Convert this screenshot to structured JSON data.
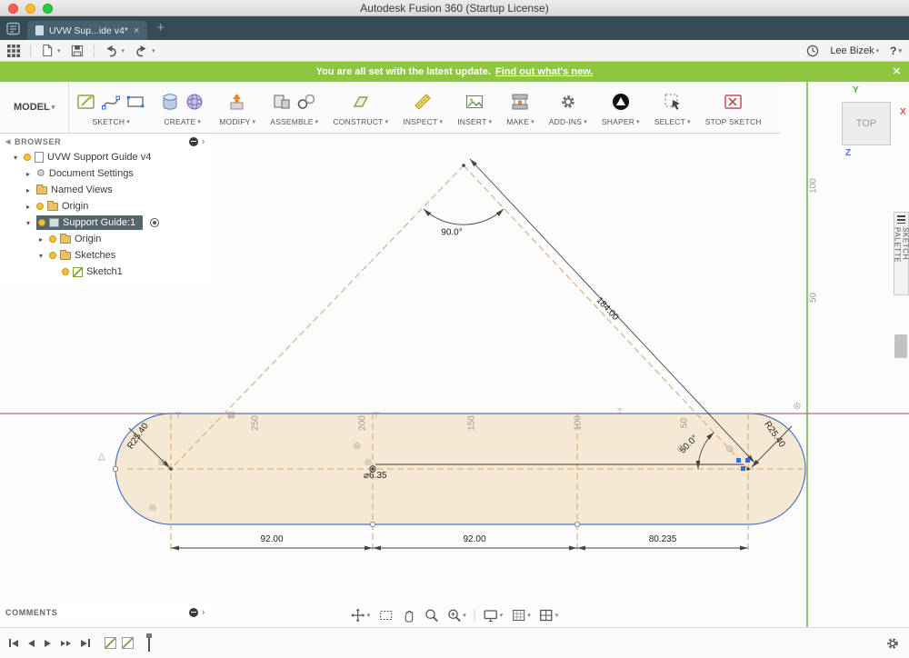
{
  "window": {
    "title": "Autodesk Fusion 360 (Startup License)"
  },
  "tabbar": {
    "active_tab": "UVW Sup...ide v4*",
    "close_glyph": "×",
    "new_tab_glyph": "+"
  },
  "appbar": {
    "user_name": "Lee Bizek",
    "help_label": "?"
  },
  "banner": {
    "message": "You are all set with the latest update.",
    "link_label": "Find out what's new.",
    "close_glyph": "✕"
  },
  "ribbon": {
    "model_label": "MODEL",
    "groups": [
      {
        "label": "SKETCH"
      },
      {
        "label": "CREATE"
      },
      {
        "label": "MODIFY"
      },
      {
        "label": "ASSEMBLE"
      },
      {
        "label": "CONSTRUCT"
      },
      {
        "label": "INSPECT"
      },
      {
        "label": "INSERT"
      },
      {
        "label": "MAKE"
      },
      {
        "label": "ADD-INS"
      },
      {
        "label": "SHAPER"
      },
      {
        "label": "SELECT"
      },
      {
        "label": "STOP SKETCH"
      }
    ]
  },
  "browser": {
    "header": "BROWSER",
    "items": [
      {
        "label": "UVW Support Guide v4"
      },
      {
        "label": "Document Settings"
      },
      {
        "label": "Named Views"
      },
      {
        "label": "Origin"
      },
      {
        "label": "Support Guide:1",
        "selected": true
      },
      {
        "label": "Origin"
      },
      {
        "label": "Sketches"
      },
      {
        "label": "Sketch1"
      }
    ]
  },
  "viewcube": {
    "face_label": "TOP",
    "axis_x": "X",
    "axis_y": "Y",
    "axis_z": "Z"
  },
  "right_panel": {
    "sketch_palette_label": "SKETCH PALETTE"
  },
  "comments": {
    "label": "COMMENTS"
  },
  "sketch": {
    "angle_apex": "90.0°",
    "length_hypotenuse": "184.00",
    "width_left": "92.00",
    "width_mid": "92.00",
    "width_right": "80.235",
    "radius_left": "R25.40",
    "radius_right": "R25.40",
    "diameter_mid": "⌀6.35",
    "angle_right": "50.0°",
    "ruler_x": [
      "250",
      "200",
      "150",
      "100",
      "50"
    ],
    "ruler_y": [
      "100",
      "50"
    ]
  },
  "colors": {
    "banner_green": "#8dc63f",
    "axis_x_red": "#a34e4e",
    "axis_y_green": "#6fae4a",
    "construction_orange": "#d9a267",
    "profile_blue": "#4a73c0",
    "profile_fill": "#f6e9d4",
    "selection_blue": "#2e6fd0",
    "tabbar_dark": "#364b54"
  }
}
